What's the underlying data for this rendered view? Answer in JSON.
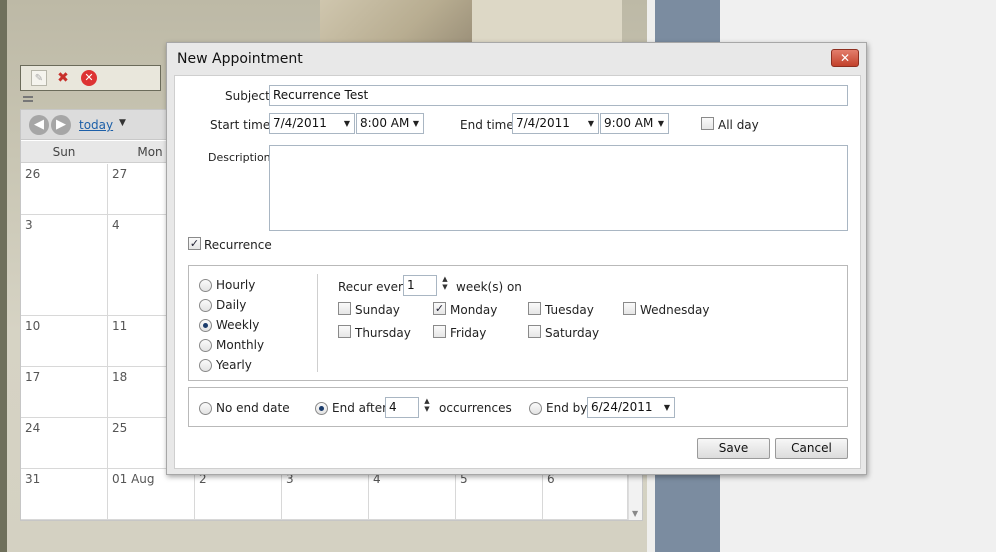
{
  "background": {
    "toolbar": {
      "edit_icon": "edit-icon",
      "delete_icon": "x-icon",
      "remove_icon": "close-circle-icon"
    },
    "calendar": {
      "today_label": "today",
      "day_headers": [
        "Sun",
        "Mon"
      ],
      "rows": [
        [
          "26",
          "27"
        ],
        [
          "3",
          "4"
        ],
        [
          "10",
          "11"
        ],
        [
          "17",
          "18"
        ],
        [
          "24",
          "25"
        ],
        [
          "31",
          "01 Aug",
          "2",
          "3",
          "4",
          "5",
          "6"
        ]
      ]
    }
  },
  "dialog": {
    "title": "New Appointment",
    "close_label": "✕",
    "subject_label": "Subject",
    "subject_value": "Recurrence Test",
    "start_label": "Start time",
    "start_date": "7/4/2011",
    "start_time": "8:00 AM",
    "end_label": "End time",
    "end_date": "7/4/2011",
    "end_time": "9:00 AM",
    "all_day_label": "All day",
    "description_label": "Description",
    "recurrence_label": "Recurrence",
    "patterns": [
      "Hourly",
      "Daily",
      "Weekly",
      "Monthly",
      "Yearly"
    ],
    "selected_pattern": "Weekly",
    "recur_every_label": "Recur every",
    "recur_every_value": "1",
    "weeks_on_label": "week(s) on",
    "days": [
      {
        "label": "Sunday",
        "checked": false
      },
      {
        "label": "Monday",
        "checked": true
      },
      {
        "label": "Tuesday",
        "checked": false
      },
      {
        "label": "Wednesday",
        "checked": false
      },
      {
        "label": "Thursday",
        "checked": false
      },
      {
        "label": "Friday",
        "checked": false
      },
      {
        "label": "Saturday",
        "checked": false
      }
    ],
    "no_end_label": "No end date",
    "end_after_label": "End after",
    "end_after_value": "4",
    "occurrences_label": "occurrences",
    "end_by_label": "End by",
    "end_by_date": "6/24/2011",
    "selected_range": "End after",
    "save_label": "Save",
    "cancel_label": "Cancel"
  }
}
